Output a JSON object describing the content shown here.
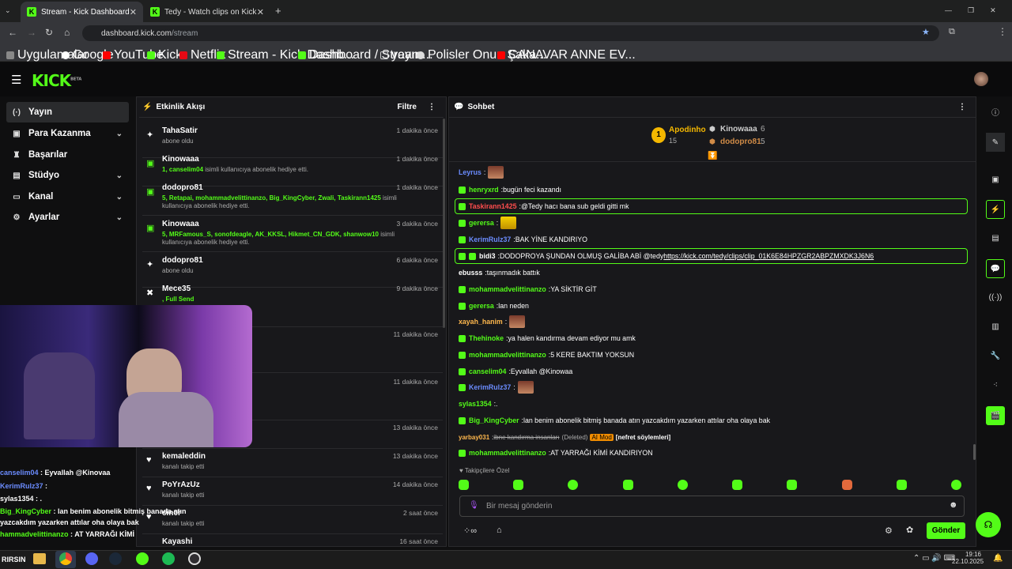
{
  "browser": {
    "tabs": [
      {
        "title": "Stream - Kick Dashboard"
      },
      {
        "title": "Tedy - Watch clips on Kick"
      }
    ],
    "url_host": "dashboard.kick.com",
    "url_path": "/stream",
    "bookmarks": [
      "Uygulamalar",
      "Google",
      "YouTube",
      "Kick",
      "Netflix",
      "Stream - Kick Dashb...",
      "Dashboard / Stream...",
      "yayın",
      "Polisler Onun Şaka...",
      "CANAVAR ANNE EV..."
    ]
  },
  "logo": {
    "text": "KICK",
    "beta": "BETA"
  },
  "sidebar": {
    "items": [
      {
        "label": "Yayın",
        "icon": "broadcast-icon"
      },
      {
        "label": "Para Kazanma",
        "icon": "money-icon"
      },
      {
        "label": "Başarılar",
        "icon": "trophy-icon"
      },
      {
        "label": "Stüdyo",
        "icon": "studio-icon"
      },
      {
        "label": "Kanal",
        "icon": "channel-icon"
      },
      {
        "label": "Ayarlar",
        "icon": "settings-icon"
      }
    ]
  },
  "activity": {
    "title": "Etkinlik Akışı",
    "filter": "Filtre",
    "events": [
      {
        "name": "TahaSatir",
        "sub": "abone oldu",
        "time": "1 dakika önce"
      },
      {
        "name": "Kinowaaa",
        "hl": "1, canselim04",
        "sub": " isimli kullanıcıya abonelik hediye etti.",
        "time": "1 dakika önce"
      },
      {
        "name": "dodopro81",
        "hl": "5, Retapai, mohammadvelittinanzo, Big_KingCyber, Zwali, Taskirann1425",
        "sub": " isimli kullanıcıya abonelik hediye etti.",
        "time": "1 dakika önce"
      },
      {
        "name": "Kinowaaa",
        "hl": "5, MRFamous_S, sonofdeagle, AK_KKSL, Hikmet_CN_GDK, shanwow10",
        "sub": " isimli kullanıcıya abonelik hediye etti.",
        "time": "3 dakika önce"
      },
      {
        "name": "dodopro81",
        "sub": "abone oldu",
        "time": "6 dakika önce"
      },
      {
        "name": "Mece35",
        "hl": ", Full Send",
        "sub": "",
        "time": "9 dakika önce"
      },
      {
        "name": "",
        "sub": "",
        "time": "11 dakika önce"
      },
      {
        "name": "",
        "sub": "",
        "time": "11 dakika önce"
      },
      {
        "name": "",
        "sub": "",
        "time": "13 dakika önce"
      },
      {
        "name": "kemaleddin",
        "sub": "kanalı takip etti",
        "time": "13 dakika önce"
      },
      {
        "name": "PoYrAzUz",
        "sub": "kanalı takip etti",
        "time": "14 dakika önce"
      },
      {
        "name": "cin0r",
        "sub": "kanalı takip etti",
        "time": "2 saat önce"
      },
      {
        "name": "Kayashi",
        "sub": "",
        "time": "16 saat önce"
      }
    ]
  },
  "chat": {
    "title": "Sohbet",
    "top": [
      {
        "rank": "1",
        "name": "Apodinho",
        "count": "15"
      },
      {
        "name": "Kinowaaa",
        "count": "6"
      },
      {
        "name": "dodopro81",
        "count": "5"
      }
    ],
    "messages": [
      {
        "user": "Leyrus",
        "color": "#6b8cff",
        "text": "",
        "emote": true
      },
      {
        "user": "henryxrd",
        "color": "#53fc18",
        "text": "bugün feci kazandı"
      },
      {
        "user": "Taskirann1425",
        "color": "#ff4d4d",
        "text": "@Tedy hacı bana sub geldi gitti mk",
        "hl": true
      },
      {
        "user": "gerersa",
        "color": "#53fc18",
        "text": "",
        "emote": true
      },
      {
        "user": "KerimRulz37",
        "color": "#6b8cff",
        "text": "BAK YİNE KANDIRIYO"
      },
      {
        "user": "bidi3",
        "color": "#ffffff",
        "text": "DODOPROYA ŞUNDAN OLMUŞ GALİBA ABİ @tedy ",
        "link": "https://kick.com/tedy/clips/clip_01K6E84HPZGR2ABPZMXDK3J6N6",
        "hl": true
      },
      {
        "user": "ebusss",
        "color": "#ffffff",
        "text": "taşınmadık battık"
      },
      {
        "user": "mohammadvelittinanzo",
        "color": "#53fc18",
        "text": "YA SİKTİR GİT"
      },
      {
        "user": "gerersa",
        "color": "#53fc18",
        "text": "lan neden"
      },
      {
        "user": "xayah_hanim",
        "color": "#ffb84d",
        "text": "",
        "emote": true
      },
      {
        "user": "Thehinoke",
        "color": "#53fc18",
        "text": "ya halen kandırma devam ediyor mu amk"
      },
      {
        "user": "mohammadvelittinanzo",
        "color": "#53fc18",
        "text": "5 KERE BAKTIM YOKSUN"
      },
      {
        "user": "canselim04",
        "color": "#53fc18",
        "text": "Eyvallah @Kinowaa"
      },
      {
        "user": "KerimRulz37",
        "color": "#6b8cff",
        "text": "",
        "emote": true
      },
      {
        "user": "sylas1354",
        "color": "#53fc18",
        "text": "."
      },
      {
        "user": "Big_KingCyber",
        "color": "#53fc18",
        "text": "lan benim abonelik bitmiş banada atın yazcakdım yazarken attılar oha olaya bak"
      },
      {
        "user": "yarbay031",
        "color": "#ffb84d",
        "text": "ibne kandırma insanları",
        "deleted": "(Deleted)",
        "mod": "AI Mod",
        "reason": "[nefret söylemleri]"
      },
      {
        "user": "mohammadvelittinanzo",
        "color": "#53fc18",
        "text": "AT YARRAĞI KİMİ KANDIRIYON"
      }
    ],
    "followers_only": "Takipçilere Özel",
    "placeholder": "Bir mesaj gönderin",
    "send": "Gönder"
  },
  "overlay": {
    "messages": [
      {
        "user": "canselim04",
        "text": "Eyvallah @Kinovaa"
      },
      {
        "user": "KerimRulz37",
        "text": ""
      },
      {
        "user": "sylas1354",
        "text": "."
      },
      {
        "user": "Big_KingCyber",
        "text": "lan benim abonelik bitmiş banada atın yazcakdım yazarken attılar oha olaya bak"
      },
      {
        "user": "hammadvelittinanzo",
        "text": "AT YARRAĞI KİMİ"
      }
    ],
    "bottom": "RIRSIN"
  },
  "taskbar": {
    "time": "19:16",
    "date": "22.10.2025"
  }
}
